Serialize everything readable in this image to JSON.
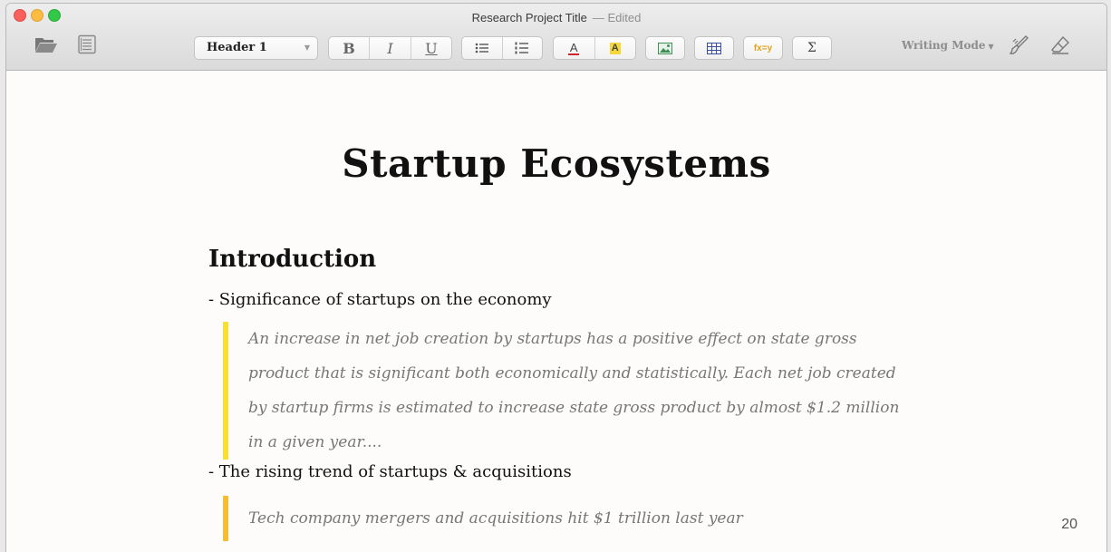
{
  "window": {
    "title": "Research Project Title",
    "status": "— Edited"
  },
  "toolbar": {
    "style_dropdown": "Header 1",
    "bold": "B",
    "italic": "I",
    "underline": "U",
    "font_color_label": "A",
    "highlight_label": "A",
    "formula_label": "fx=y",
    "sum_label": "Σ",
    "writing_mode": "Writing Mode"
  },
  "document": {
    "title": "Startup Ecosystems",
    "section_heading": "Introduction",
    "bullets": [
      {
        "text": "- Significance of startups on the economy",
        "quote": "An increase in net job creation by startups has a positive effect on state gross product that is significant both economically and statistically. Each net job created by startup firms is estimated to increase state gross product by almost $1.2 million in a given year....",
        "bar_color": "#f8df36"
      },
      {
        "text": "- The rising trend of startups & acquisitions",
        "quote": "Tech company mergers and acquisitions hit $1 trillion last year",
        "bar_color": "#f4bd36"
      }
    ],
    "page_number": "20"
  }
}
